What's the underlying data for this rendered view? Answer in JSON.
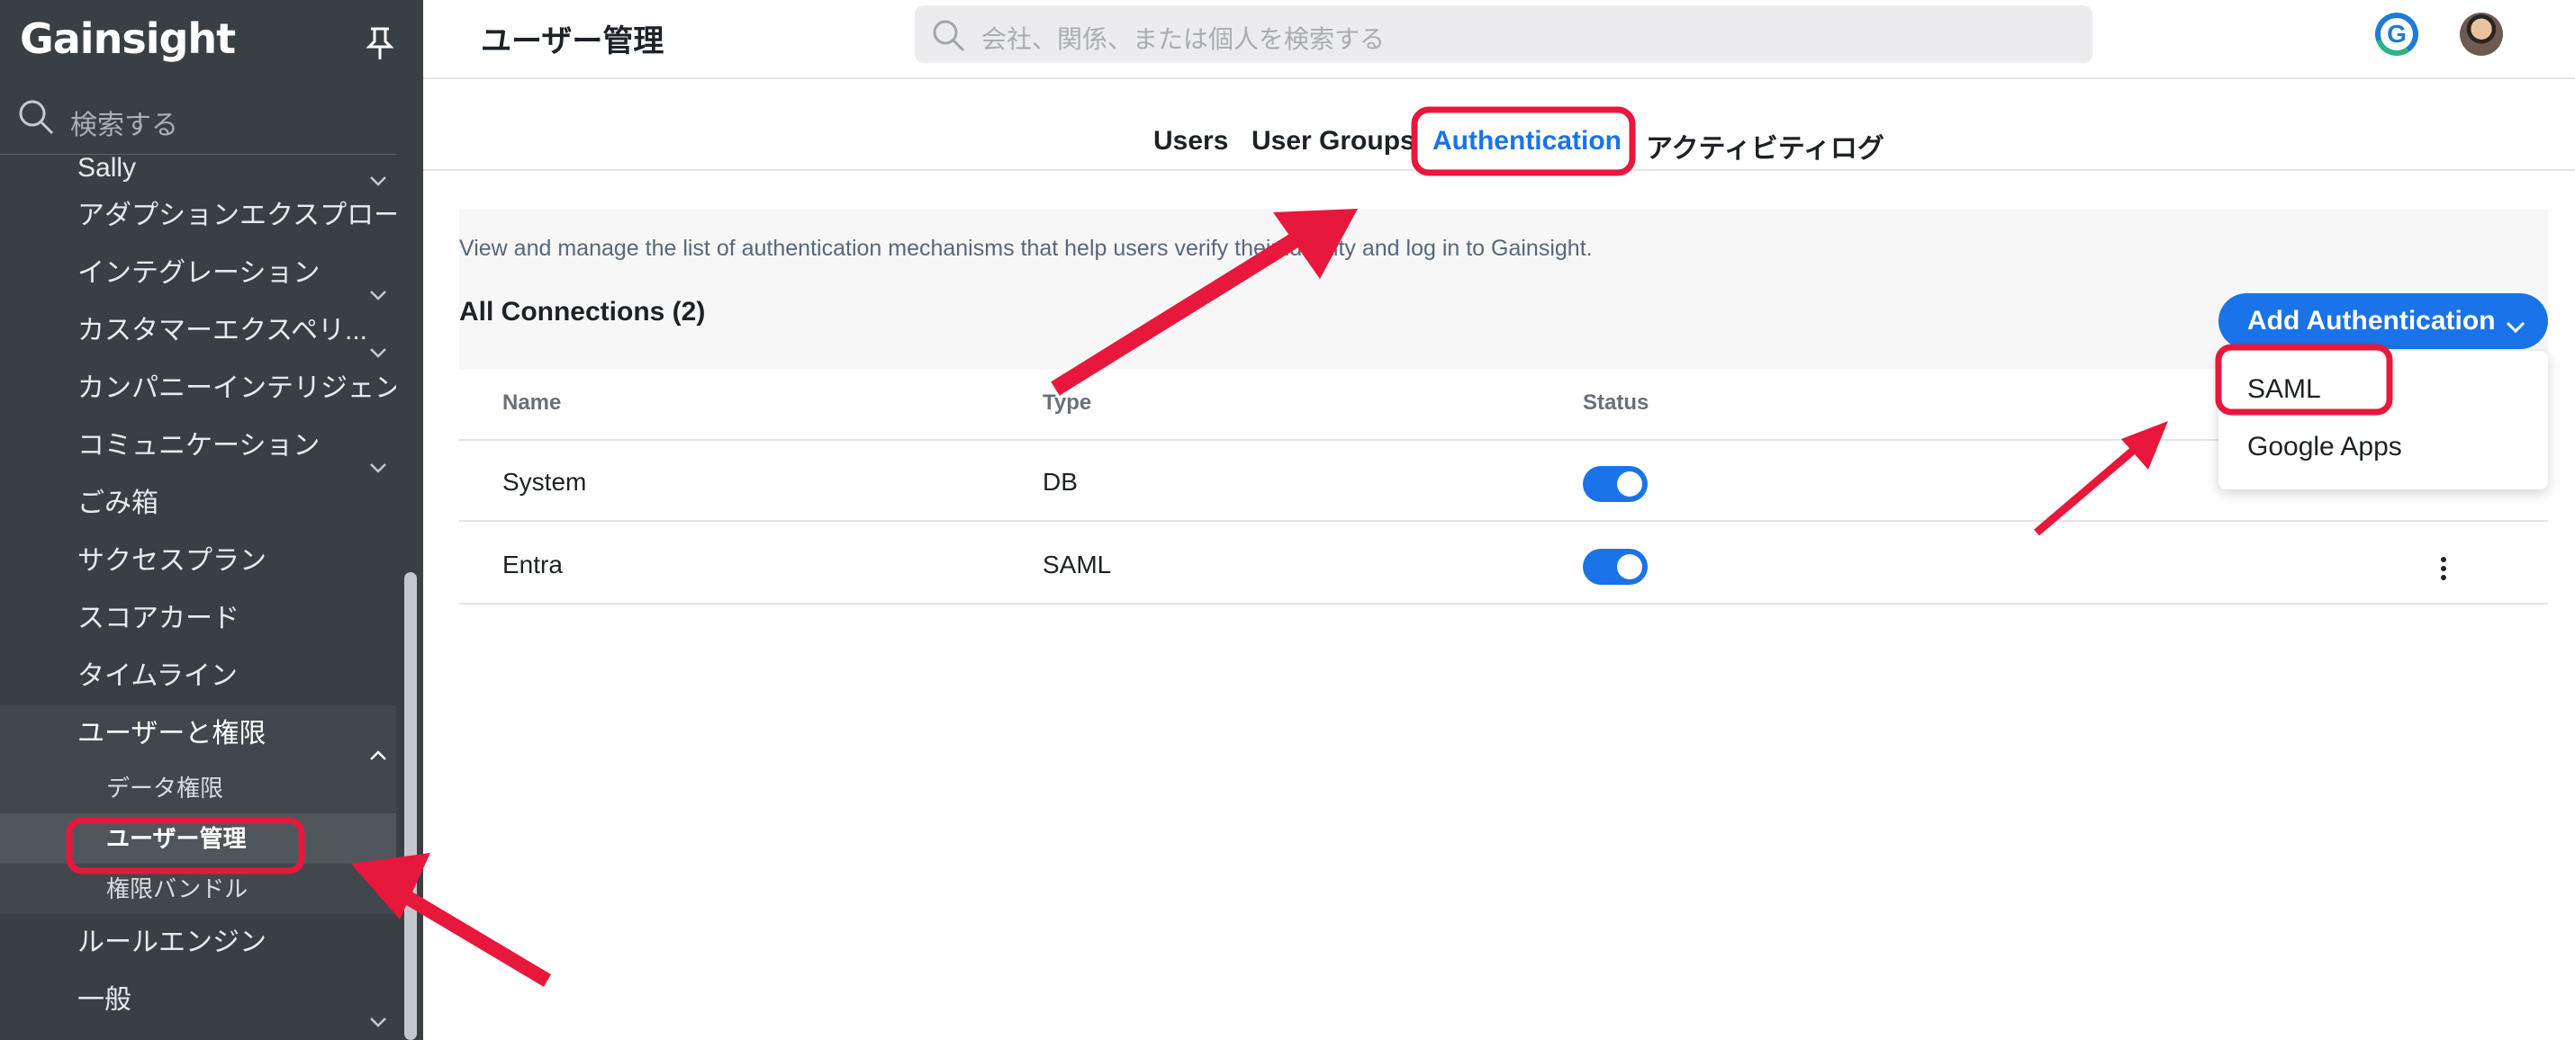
{
  "sidebar": {
    "brand": "Gainsight",
    "search_placeholder": "検索する",
    "items": [
      {
        "label": "Sally"
      },
      {
        "label": "アダプションエクスプローラ"
      },
      {
        "label": "インテグレーション"
      },
      {
        "label": "カスタマーエクスペリ..."
      },
      {
        "label": "カンパニーインテリジェンス"
      },
      {
        "label": "コミュニケーション"
      },
      {
        "label": "ごみ箱"
      },
      {
        "label": "サクセスプラン"
      },
      {
        "label": "スコアカード"
      },
      {
        "label": "タイムライン"
      },
      {
        "label": "ユーザーと権限"
      },
      {
        "label": "ルールエンジン"
      },
      {
        "label": "一般"
      }
    ],
    "sub_items": [
      {
        "label": "データ権限"
      },
      {
        "label": "ユーザー管理"
      },
      {
        "label": "権限バンドル"
      }
    ]
  },
  "header": {
    "title": "ユーザー管理",
    "search_placeholder": "会社、関係、または個人を検索する"
  },
  "tabs": [
    {
      "label": "Users"
    },
    {
      "label": "User Groups"
    },
    {
      "label": "Authentication",
      "active": true
    },
    {
      "label": "アクティビティログ"
    }
  ],
  "main": {
    "description": "View and manage the list of authentication mechanisms that help users verify their identity and log in to Gainsight.",
    "connections_title": "All Connections (2)",
    "add_button": "Add Authentication",
    "columns": [
      "Name",
      "Type",
      "Status"
    ],
    "rows": [
      {
        "name": "System",
        "type": "DB",
        "status": true
      },
      {
        "name": "Entra",
        "type": "SAML",
        "status": true
      }
    ],
    "dropdown": [
      "SAML",
      "Google Apps"
    ]
  },
  "colors": {
    "accent": "#1a73e8",
    "sidebar_bg": "#3a3f44",
    "annotation": "#e8173c"
  }
}
